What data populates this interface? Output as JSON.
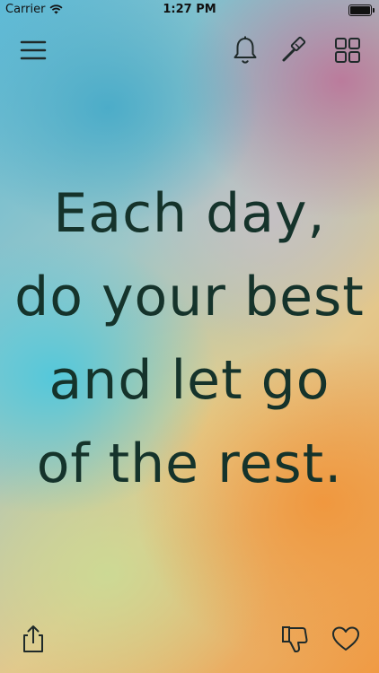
{
  "status_bar": {
    "carrier": "Carrier",
    "time": "1:27 PM"
  },
  "toolbar": {
    "menu_icon": "hamburger-menu-icon",
    "bell_icon": "bell-icon",
    "brush_icon": "paint-brush-icon",
    "grid_icon": "grid-icon"
  },
  "quote": {
    "lines": [
      "Each day,",
      "do your best",
      "and let go",
      "of the rest."
    ]
  },
  "bottom_bar": {
    "share_icon": "share-icon",
    "dislike_icon": "thumbs-down-icon",
    "like_icon": "heart-icon"
  },
  "colors": {
    "text": "#15332b",
    "icon": "#1f2a2a"
  }
}
